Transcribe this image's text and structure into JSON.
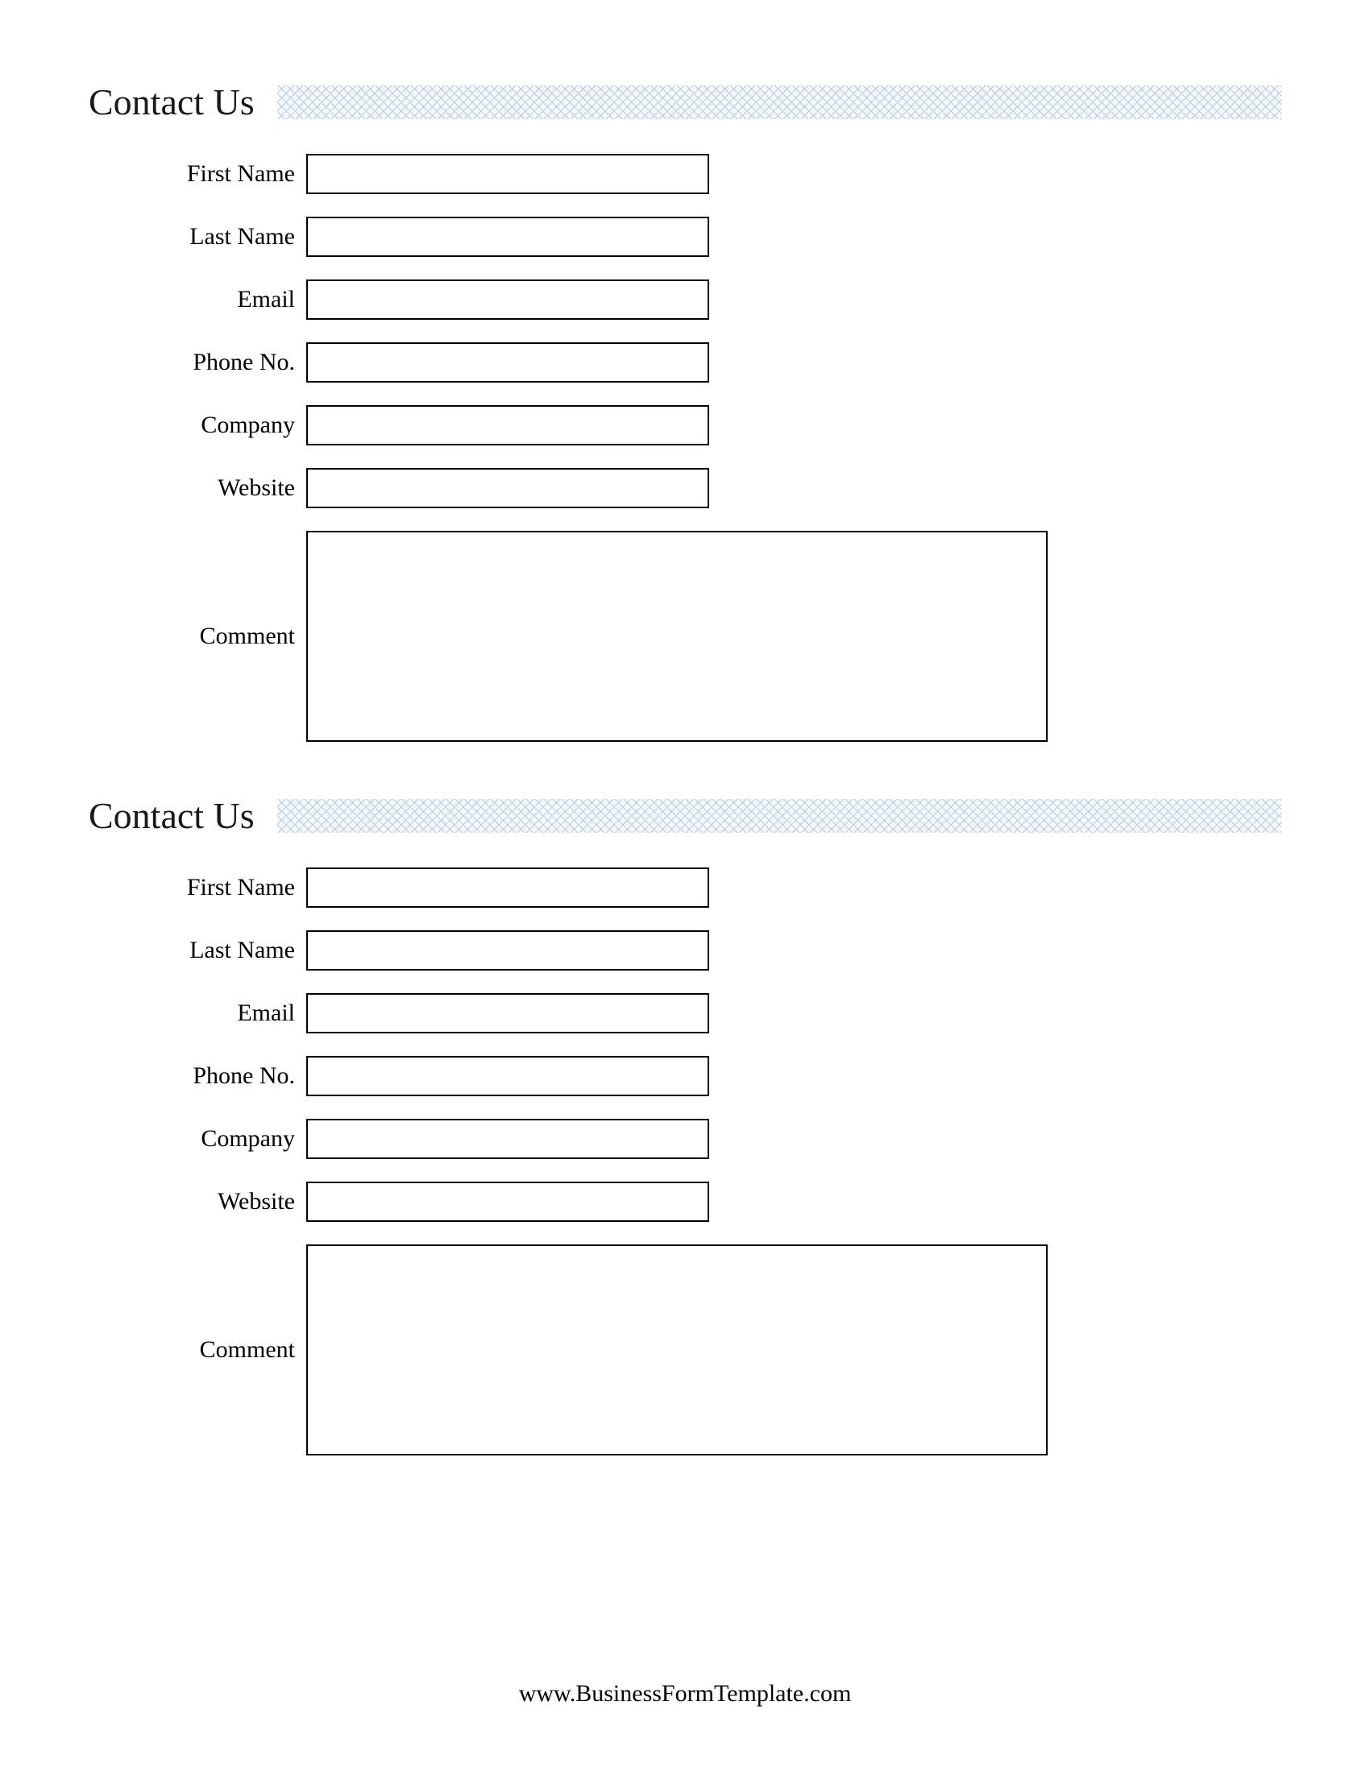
{
  "form1": {
    "title": "Contact Us",
    "fields": {
      "firstName": {
        "label": "First Name",
        "value": ""
      },
      "lastName": {
        "label": "Last Name",
        "value": ""
      },
      "email": {
        "label": "Email",
        "value": ""
      },
      "phone": {
        "label": "Phone No.",
        "value": ""
      },
      "company": {
        "label": "Company",
        "value": ""
      },
      "website": {
        "label": "Website",
        "value": ""
      },
      "comment": {
        "label": "Comment",
        "value": ""
      }
    }
  },
  "form2": {
    "title": "Contact Us",
    "fields": {
      "firstName": {
        "label": "First Name",
        "value": ""
      },
      "lastName": {
        "label": "Last Name",
        "value": ""
      },
      "email": {
        "label": "Email",
        "value": ""
      },
      "phone": {
        "label": "Phone No.",
        "value": ""
      },
      "company": {
        "label": "Company",
        "value": ""
      },
      "website": {
        "label": "Website",
        "value": ""
      },
      "comment": {
        "label": "Comment",
        "value": ""
      }
    }
  },
  "footer": {
    "text": "www.BusinessFormTemplate.com"
  }
}
